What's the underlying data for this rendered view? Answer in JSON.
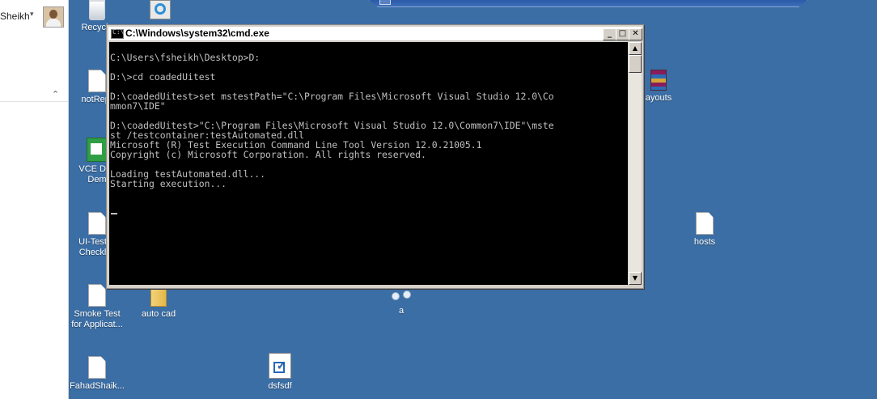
{
  "left_panel": {
    "user_name": "Sheikh",
    "user_caret": "▾",
    "collapse_caret": "⌃"
  },
  "cmd_window": {
    "title": "C:\\Windows\\system32\\cmd.exe",
    "icon_text": "C:\\",
    "minimize": "_",
    "maximize": "□",
    "close": "✕",
    "lines": [
      "C:\\Users\\fsheikh\\Desktop>D:",
      "",
      "D:\\>cd coadedUitest",
      "",
      "D:\\coadedUitest>set mstestPath=\"C:\\Program Files\\Microsoft Visual Studio 12.0\\Co",
      "mmon7\\IDE\"",
      "",
      "D:\\coadedUitest>\"C:\\Program Files\\Microsoft Visual Studio 12.0\\Common7\\IDE\"\\mste",
      "st /testcontainer:testAutomated.dll",
      "Microsoft (R) Test Execution Command Line Tool Version 12.0.21005.1",
      "Copyright (c) Microsoft Corporation. All rights reserved.",
      "",
      "Loading testAutomated.dll...",
      "Starting execution..."
    ],
    "scroll_up": "▲",
    "scroll_down": "▼"
  },
  "desktop_icons": {
    "recycle": "Recycle",
    "notrep": "notRepr",
    "vce": [
      "VCE Des",
      "Dem"
    ],
    "uitest": [
      "UI-Test C",
      "Checklist"
    ],
    "smoke": [
      "Smoke Test",
      "for Applicat..."
    ],
    "autocad": "auto cad",
    "fahad": "FahadShaik...",
    "dsfsdf": "dsfsdf",
    "a": "a",
    "layouts": "ayouts",
    "hosts": "hosts"
  },
  "colors": {
    "desktop": "#3b6ea5",
    "console_bg": "#000000",
    "console_fg": "#c0c0c0"
  }
}
